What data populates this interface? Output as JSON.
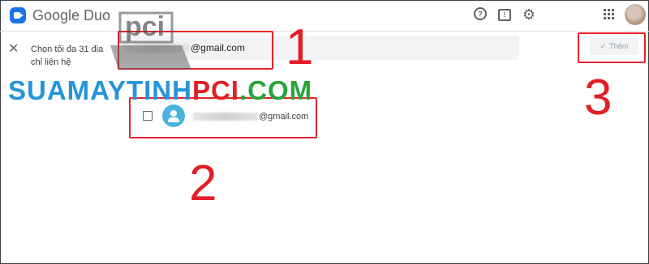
{
  "app": {
    "title": "Google Duo",
    "accent": "#1a73e8"
  },
  "topbar": {
    "icons": [
      "help-icon",
      "feedback-icon",
      "gear-icon",
      "apps-icon"
    ]
  },
  "picker": {
    "hint": "Chọn tối đa 31 địa chỉ liên hệ",
    "search_value_suffix": "@gmail.com",
    "add_button_label": "Thêm"
  },
  "contacts": [
    {
      "email_suffix": "@gmail.com"
    }
  ],
  "annotations": {
    "one": "1",
    "two": "2",
    "three": "3",
    "color": "#e31e24"
  },
  "watermark": {
    "part1": "SUAMAYTINH",
    "part2": "PCI",
    "part3": ".COM",
    "logo_text": "pci"
  }
}
